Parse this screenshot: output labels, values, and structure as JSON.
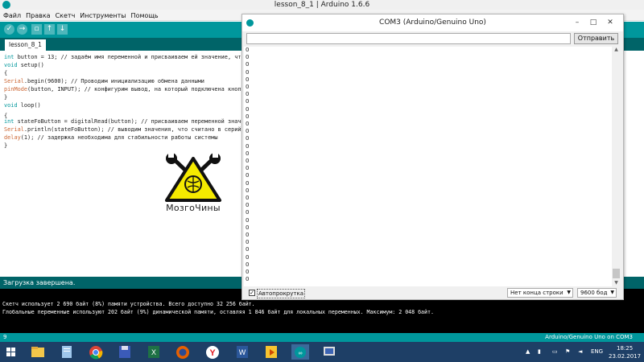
{
  "ide": {
    "title": "lesson_8_1 | Arduino 1.6.6",
    "menu": [
      "Файл",
      "Правка",
      "Скетч",
      "Инструменты",
      "Помощь"
    ],
    "toolbar_icons": [
      "verify-icon",
      "upload-icon",
      "new-icon",
      "open-icon",
      "save-icon"
    ],
    "tab": "lesson_8_1",
    "code": [
      {
        "kw": "int",
        "rest": " button = 13; // задаём имя переменной и присваиваем ей значение, что"
      },
      {
        "kw": "void",
        "rest": " setup()"
      },
      {
        "kw": "",
        "rest": "{"
      },
      {
        "kw": "Serial",
        "rest": ".begin(9600); // Проводим инициализацию обмена данными"
      },
      {
        "kw": "pinMode",
        "rest": "(button, INPUT); // конфигурим вывод, на который подключена кнопк"
      },
      {
        "kw": "",
        "rest": "}"
      },
      {
        "kw": "void",
        "rest": " loop()"
      },
      {
        "kw": "",
        "rest": "{"
      },
      {
        "kw": "int",
        "rest": " stateFoButton = digitalRead(button); // присваиваем переменной значе"
      },
      {
        "kw": "Serial",
        "rest": ".println(stateFoButton); // выводим значения, что считано в серийн"
      },
      {
        "kw": "delay",
        "rest": "(1); // задержка необходима для стабильности работы системы"
      },
      {
        "kw": "",
        "rest": "}"
      }
    ],
    "logo_text": "МозгоЧины",
    "status": "Загрузка завершена.",
    "console": [
      "Скетч использует 2 690 байт (8%) памяти устройства. Всего доступно 32 256 байт.",
      "Глобальные переменные используют 202 байт (9%) динамической памяти, оставляя 1 846 байт для локальных переменных. Максимум: 2 048 байт."
    ],
    "line_number": "9",
    "board": "Arduino/Genuino Uno on COM3"
  },
  "serial": {
    "title": "COM3 (Arduino/Genuino Uno)",
    "input_value": "",
    "send_label": "Отправить",
    "output_value": "0",
    "autoscroll_label": "Автопрокрутка",
    "autoscroll_checked": true,
    "line_ending": "Нет конца строки",
    "baud": "9600 бод"
  },
  "taskbar": {
    "apps": [
      "file-explorer-icon",
      "notepad-icon",
      "chrome-icon",
      "floppy-save-icon",
      "excel-icon",
      "firefox-icon",
      "yandex-icon",
      "word-icon",
      "media-player-icon",
      "arduino-icon",
      "presentation-icon"
    ],
    "language": "ENG",
    "time": "18:25",
    "date": "23.02.2017"
  }
}
